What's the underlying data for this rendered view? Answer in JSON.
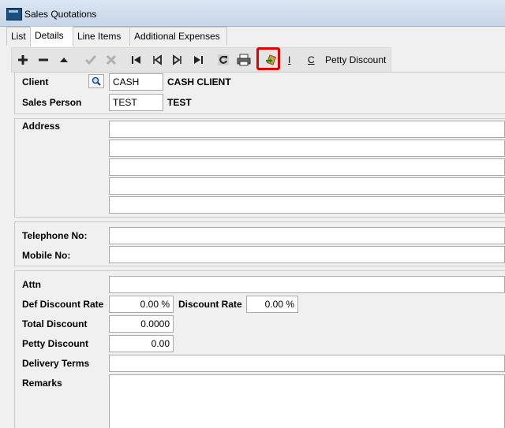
{
  "window": {
    "title": "Sales Quotations"
  },
  "tabs": [
    "List",
    "Details",
    "Line Items",
    "Additional Expenses"
  ],
  "toolbar": {
    "i_label": "I",
    "c_label": "C",
    "petty_discount_label": "Petty Discount"
  },
  "client": {
    "label": "Client",
    "code": "CASH",
    "name": "CASH CLIENT"
  },
  "sales_person": {
    "label": "Sales Person",
    "code": "TEST",
    "name": "TEST"
  },
  "address": {
    "label": "Address",
    "lines": [
      "",
      "",
      "",
      "",
      ""
    ]
  },
  "telephone": {
    "label": "Telephone No:",
    "value": ""
  },
  "mobile": {
    "label": "Mobile No:",
    "value": ""
  },
  "attn": {
    "label": "Attn",
    "value": ""
  },
  "def_discount_rate": {
    "label": "Def Discount Rate",
    "value": "0.00 %"
  },
  "discount_rate": {
    "label": "Discount Rate",
    "value": "0.00 %"
  },
  "total_discount": {
    "label": "Total Discount",
    "value": "0.0000"
  },
  "petty_discount": {
    "label": "Petty Discount",
    "value": "0.00"
  },
  "delivery_terms": {
    "label": "Delivery Terms",
    "value": ""
  },
  "remarks": {
    "label": "Remarks",
    "value": ""
  },
  "colors": {
    "highlight": "#e00000",
    "titlebar": "#c6d5e8"
  }
}
